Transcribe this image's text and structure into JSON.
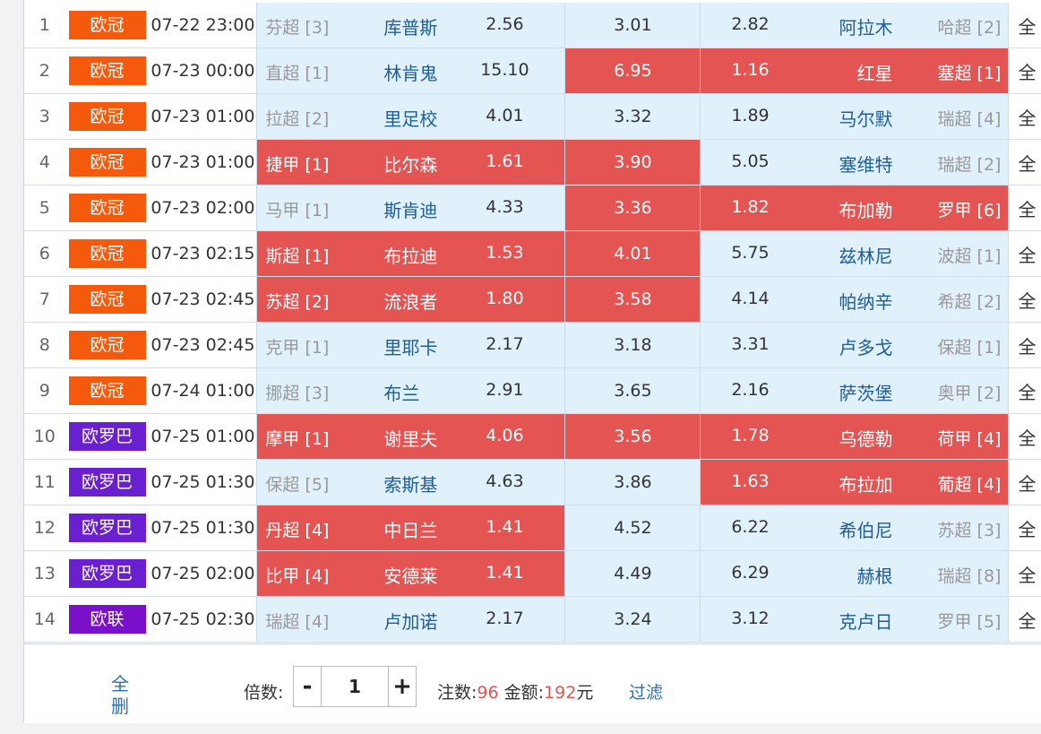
{
  "colors": {
    "league_ucl": "#f55a0c",
    "league_uel": "#6a1fd1",
    "league_ecl": "#7a10c9",
    "odds_bg": "#e1f1fc",
    "selected_bg": "#e35452",
    "team_link": "#1f5d92"
  },
  "matches": [
    {
      "no": "1",
      "league": "欧冠",
      "league_color": "#f55a0c",
      "time": "07-22 23:00",
      "home_rank": "芬超 [3]",
      "home": "库普斯",
      "home_odds": "2.56",
      "draw_odds": "3.01",
      "away_odds": "2.82",
      "away": "阿拉木",
      "away_rank": "哈超 [2]",
      "extra": "全",
      "sel_home": false,
      "sel_draw": false,
      "sel_away": false
    },
    {
      "no": "2",
      "league": "欧冠",
      "league_color": "#f55a0c",
      "time": "07-23 00:00",
      "home_rank": "直超 [1]",
      "home": "林肯鬼",
      "home_odds": "15.10",
      "draw_odds": "6.95",
      "away_odds": "1.16",
      "away": "红星",
      "away_rank": "塞超 [1]",
      "extra": "全",
      "sel_home": false,
      "sel_draw": true,
      "sel_away": true
    },
    {
      "no": "3",
      "league": "欧冠",
      "league_color": "#f55a0c",
      "time": "07-23 01:00",
      "home_rank": "拉超 [2]",
      "home": "里足校",
      "home_odds": "4.01",
      "draw_odds": "3.32",
      "away_odds": "1.89",
      "away": "马尔默",
      "away_rank": "瑞超 [4]",
      "extra": "全",
      "sel_home": false,
      "sel_draw": false,
      "sel_away": false
    },
    {
      "no": "4",
      "league": "欧冠",
      "league_color": "#f55a0c",
      "time": "07-23 01:00",
      "home_rank": "捷甲 [1]",
      "home": "比尔森",
      "home_odds": "1.61",
      "draw_odds": "3.90",
      "away_odds": "5.05",
      "away": "塞维特",
      "away_rank": "瑞超 [2]",
      "extra": "全",
      "sel_home": true,
      "sel_draw": true,
      "sel_away": false
    },
    {
      "no": "5",
      "league": "欧冠",
      "league_color": "#f55a0c",
      "time": "07-23 02:00",
      "home_rank": "马甲 [1]",
      "home": "斯肯迪",
      "home_odds": "4.33",
      "draw_odds": "3.36",
      "away_odds": "1.82",
      "away": "布加勒",
      "away_rank": "罗甲 [6]",
      "extra": "全",
      "sel_home": false,
      "sel_draw": true,
      "sel_away": true
    },
    {
      "no": "6",
      "league": "欧冠",
      "league_color": "#f55a0c",
      "time": "07-23 02:15",
      "home_rank": "斯超 [1]",
      "home": "布拉迪",
      "home_odds": "1.53",
      "draw_odds": "4.01",
      "away_odds": "5.75",
      "away": "兹林尼",
      "away_rank": "波超 [1]",
      "extra": "全",
      "sel_home": true,
      "sel_draw": true,
      "sel_away": false
    },
    {
      "no": "7",
      "league": "欧冠",
      "league_color": "#f55a0c",
      "time": "07-23 02:45",
      "home_rank": "苏超 [2]",
      "home": "流浪者",
      "home_odds": "1.80",
      "draw_odds": "3.58",
      "away_odds": "4.14",
      "away": "帕纳辛",
      "away_rank": "希超 [2]",
      "extra": "全",
      "sel_home": true,
      "sel_draw": true,
      "sel_away": false
    },
    {
      "no": "8",
      "league": "欧冠",
      "league_color": "#f55a0c",
      "time": "07-23 02:45",
      "home_rank": "克甲 [1]",
      "home": "里耶卡",
      "home_odds": "2.17",
      "draw_odds": "3.18",
      "away_odds": "3.31",
      "away": "卢多戈",
      "away_rank": "保超 [1]",
      "extra": "全",
      "sel_home": false,
      "sel_draw": false,
      "sel_away": false
    },
    {
      "no": "9",
      "league": "欧冠",
      "league_color": "#f55a0c",
      "time": "07-24 01:00",
      "home_rank": "挪超 [3]",
      "home": "布兰",
      "home_odds": "2.91",
      "draw_odds": "3.65",
      "away_odds": "2.16",
      "away": "萨茨堡",
      "away_rank": "奥甲 [2]",
      "extra": "全",
      "sel_home": false,
      "sel_draw": false,
      "sel_away": false
    },
    {
      "no": "10",
      "league": "欧罗巴",
      "league_color": "#6a1fd1",
      "time": "07-25 01:00",
      "home_rank": "摩甲 [1]",
      "home": "谢里夫",
      "home_odds": "4.06",
      "draw_odds": "3.56",
      "away_odds": "1.78",
      "away": "乌德勒",
      "away_rank": "荷甲 [4]",
      "extra": "全",
      "sel_home": true,
      "sel_draw": true,
      "sel_away": true
    },
    {
      "no": "11",
      "league": "欧罗巴",
      "league_color": "#6a1fd1",
      "time": "07-25 01:30",
      "home_rank": "保超 [5]",
      "home": "索斯基",
      "home_odds": "4.63",
      "draw_odds": "3.86",
      "away_odds": "1.63",
      "away": "布拉加",
      "away_rank": "葡超 [4]",
      "extra": "全",
      "sel_home": false,
      "sel_draw": false,
      "sel_away": true
    },
    {
      "no": "12",
      "league": "欧罗巴",
      "league_color": "#6a1fd1",
      "time": "07-25 01:30",
      "home_rank": "丹超 [4]",
      "home": "中日兰",
      "home_odds": "1.41",
      "draw_odds": "4.52",
      "away_odds": "6.22",
      "away": "希伯尼",
      "away_rank": "苏超 [3]",
      "extra": "全",
      "sel_home": true,
      "sel_draw": false,
      "sel_away": false
    },
    {
      "no": "13",
      "league": "欧罗巴",
      "league_color": "#6a1fd1",
      "time": "07-25 02:00",
      "home_rank": "比甲 [4]",
      "home": "安德莱",
      "home_odds": "1.41",
      "draw_odds": "4.49",
      "away_odds": "6.29",
      "away": "赫根",
      "away_rank": "瑞超 [8]",
      "extra": "全",
      "sel_home": true,
      "sel_draw": false,
      "sel_away": false
    },
    {
      "no": "14",
      "league": "欧联",
      "league_color": "#7a10c9",
      "time": "07-25 02:30",
      "home_rank": "瑞超 [4]",
      "home": "卢加诺",
      "home_odds": "2.17",
      "draw_odds": "3.24",
      "away_odds": "3.12",
      "away": "克卢日",
      "away_rank": "罗甲 [5]",
      "extra": "全",
      "sel_home": false,
      "sel_draw": false,
      "sel_away": false
    }
  ],
  "footer": {
    "clear_all": "全删",
    "multiplier_label": "倍数:",
    "minus": "-",
    "plus": "+",
    "multiplier_value": "1",
    "bets_label": "注数:",
    "bets_value": "96",
    "amount_label": "金额:",
    "amount_value": "192",
    "amount_unit": "元",
    "filter": "过滤"
  }
}
